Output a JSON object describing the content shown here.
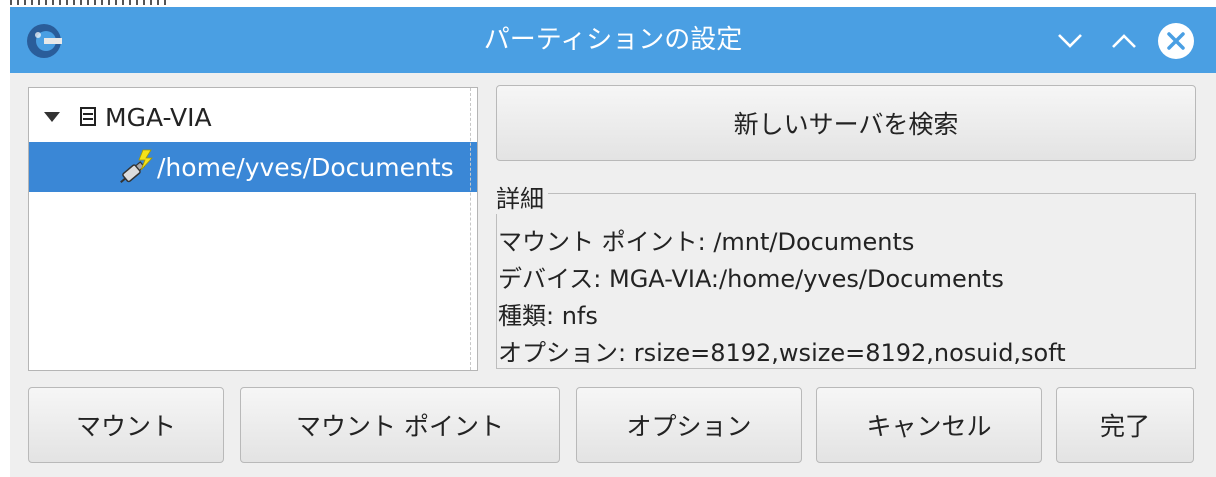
{
  "window": {
    "title": "パーティションの設定",
    "controls": {
      "minimize": "chevron-down-icon",
      "maximize": "chevron-up-icon",
      "close": "close-icon"
    }
  },
  "tree": {
    "server": {
      "label": "MGA-VIA",
      "expanded": true,
      "icon": "server-icon"
    },
    "share": {
      "label": "/home/yves/Documents",
      "icon": "nfs-share-icon",
      "selected": true
    }
  },
  "search_button": {
    "label": "新しいサーバを検索"
  },
  "details": {
    "title": "詳細",
    "mount_point": "マウント ポイント: /mnt/Documents",
    "device": "デバイス: MGA-VIA:/home/yves/Documents",
    "type": "種類: nfs",
    "options": "オプション: rsize=8192,wsize=8192,nosuid,soft"
  },
  "buttons": {
    "mount": "マウント",
    "mount_point": "マウント ポイント",
    "options": "オプション",
    "cancel": "キャンセル",
    "done": "完了"
  },
  "colors": {
    "titlebar": "#4a9fe3",
    "selection": "#3a87d6",
    "background": "#efefef"
  }
}
